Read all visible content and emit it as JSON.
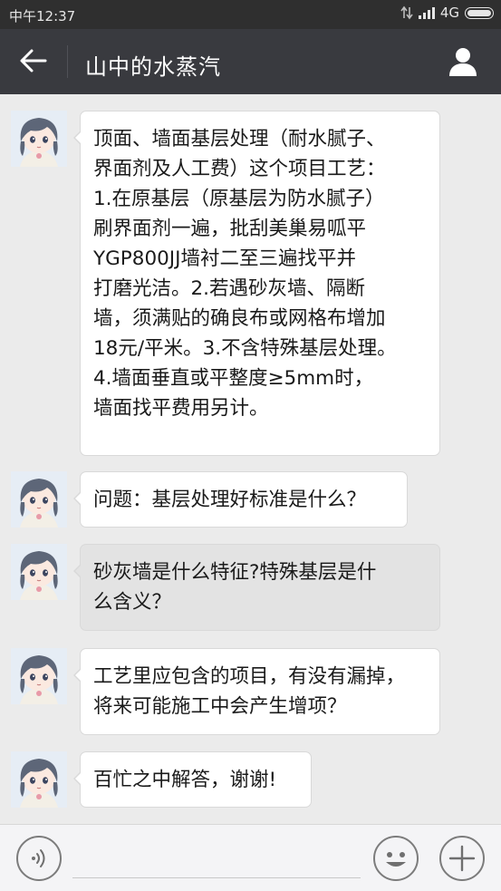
{
  "status_bar": {
    "time": "中午12:37",
    "network": "4G",
    "icons": [
      "data-arrows-icon",
      "signal-icon",
      "battery-icon"
    ]
  },
  "header": {
    "title": "山中的水蒸汽",
    "back_icon": "back-arrow-icon",
    "profile_icon": "user-profile-icon",
    "bar_color": "#393a3f"
  },
  "messages": [
    {
      "sender": "other",
      "text": "顶面、墙面基层处理（耐水腻子、\n界面剂及人工费）这个项目工艺：\n1.在原基层（原基层为防水腻子）\n刷界面剂一遍，批刮美巢易呱平\nYGP800JJ墙衬二至三遍找平并\n打磨光洁。2.若遇砂灰墙、隔断\n墙，须满贴的确良布或网格布增加\n18元/平米。3.不含特殊基层处理。\n4.墙面垂直或平整度≥5mm时，\n墙面找平费用另计。"
    },
    {
      "sender": "other",
      "text": "问题：基层处理好标准是什么？"
    },
    {
      "sender": "other",
      "text": "砂灰墙是什么特征?特殊基层是什\n么含义？",
      "highlighted": true
    },
    {
      "sender": "other",
      "text": "工艺里应包含的项目，有没有漏掉，\n将来可能施工中会产生增项？"
    },
    {
      "sender": "other",
      "text": "百忙之中解答，谢谢!"
    }
  ],
  "input_bar": {
    "voice_icon": "voice-input-icon",
    "emoji_icon": "emoji-icon",
    "plus_icon": "plus-icon"
  },
  "colors": {
    "background": "#ebebeb",
    "bubble": "#ffffff",
    "bubble_pressed": "#e3e3e3"
  }
}
